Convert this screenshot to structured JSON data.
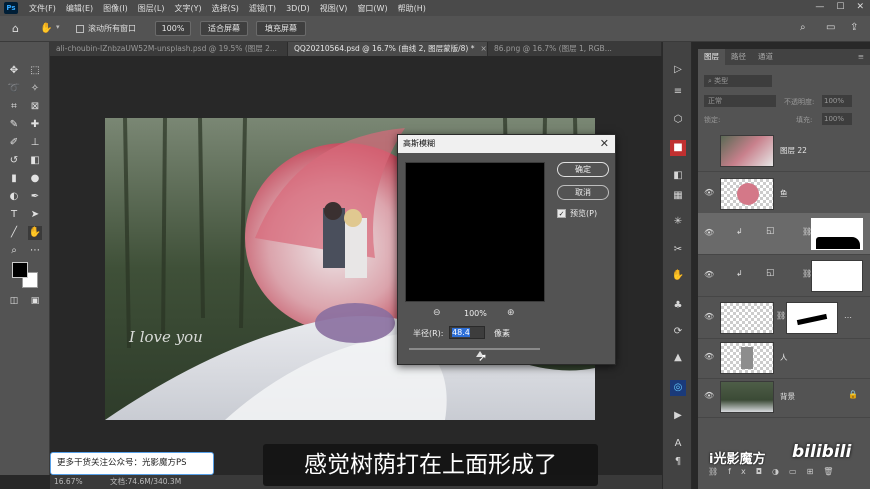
{
  "app": {
    "logo": "Ps",
    "menu": [
      "文件(F)",
      "编辑(E)",
      "图像(I)",
      "图层(L)",
      "文字(Y)",
      "选择(S)",
      "滤镜(T)",
      "3D(D)",
      "视图(V)",
      "窗口(W)",
      "帮助(H)"
    ],
    "window_controls": [
      "—",
      "☐",
      "✕"
    ]
  },
  "options": {
    "scroll_all_label": "滚动所有窗口",
    "zoom_value": "100%",
    "fit_screen_label": "适合屏幕",
    "fill_screen_label": "填充屏幕"
  },
  "tabs": [
    {
      "label": "ali-choubin-IZnbzaUW52M-unsplash.psd @ 19.5% (图层 2...",
      "active": false
    },
    {
      "label": "QQ20210564.psd @ 16.7% (曲线 2, 图层蒙版/8) *",
      "active": true
    },
    {
      "label": "86.png @ 16.7% (图层 1, RGB...",
      "active": false
    }
  ],
  "status": {
    "zoom": "16.67%",
    "doc": "文档:74.6M/340.3M"
  },
  "artwork": {
    "script_text": "I love you"
  },
  "dialog": {
    "title": "高斯模糊",
    "ok_label": "确定",
    "cancel_label": "取消",
    "preview_label": "预览(P)",
    "preview_checked": true,
    "zoom_level": "100%",
    "radius_label": "半径(R):",
    "radius_value": "48.4",
    "unit_label": "像素"
  },
  "layers_panel": {
    "tabs": [
      "图层",
      "路径",
      "通道"
    ],
    "search_placeholder": "类型",
    "blend_mode": "正常",
    "opacity_label": "不透明度:",
    "opacity_value": "100%",
    "lock_label": "锁定:",
    "fill_label": "填充:",
    "fill_value": "100%",
    "layers": [
      {
        "name": "图层 22",
        "visible": false
      },
      {
        "name": "鱼",
        "visible": true
      },
      {
        "name": "",
        "visible": true,
        "selected": true
      },
      {
        "name": "",
        "visible": true
      },
      {
        "name": "",
        "visible": true
      },
      {
        "name": "人",
        "visible": true
      },
      {
        "name": "背景",
        "visible": true
      }
    ]
  },
  "overlay": {
    "promo": "更多干货关注公众号：光影魔方PS",
    "subtitle": "感觉树荫打在上面形成了",
    "brand": "i光影魔方",
    "bilibili": "bilibili"
  }
}
